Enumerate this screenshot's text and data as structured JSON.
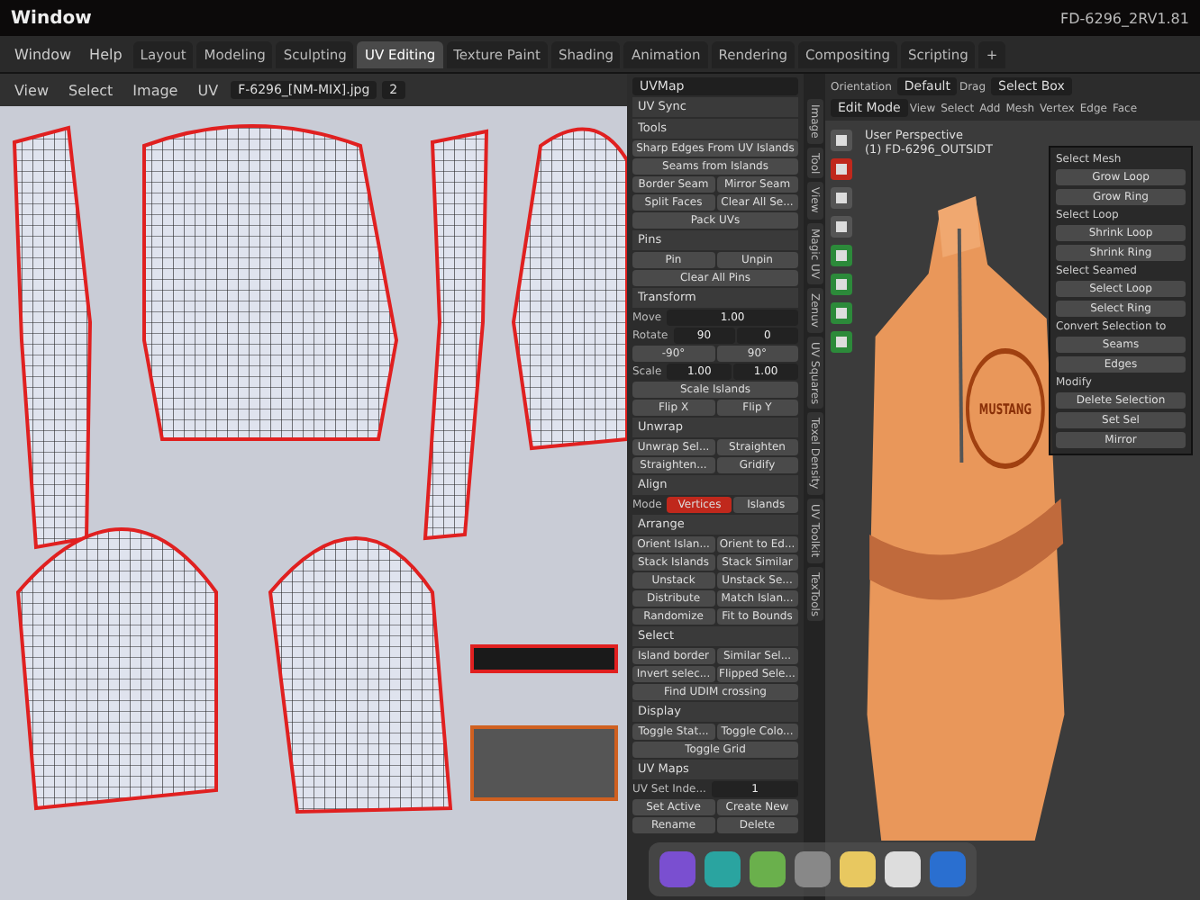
{
  "window": {
    "title": "Window",
    "file": "FD-6296_2RV1.81"
  },
  "menu": [
    "Window",
    "Help"
  ],
  "workspaces": [
    {
      "label": "Layout",
      "selected": false
    },
    {
      "label": "Modeling",
      "selected": false
    },
    {
      "label": "Sculpting",
      "selected": false
    },
    {
      "label": "UV Editing",
      "selected": true
    },
    {
      "label": "Texture Paint",
      "selected": false
    },
    {
      "label": "Shading",
      "selected": false
    },
    {
      "label": "Animation",
      "selected": false
    },
    {
      "label": "Rendering",
      "selected": false
    },
    {
      "label": "Compositing",
      "selected": false
    },
    {
      "label": "Scripting",
      "selected": false
    },
    {
      "label": "+",
      "selected": false
    }
  ],
  "uv_editor": {
    "menus": [
      "View",
      "Select",
      "Image",
      "UV"
    ],
    "image_name": "F-6296_[NM-MIX].jpg",
    "slot": "2"
  },
  "sidebar": {
    "uvmap": "UVMap",
    "sections": [
      {
        "title": "UV Sync"
      },
      {
        "title": "Tools",
        "rows": [
          {
            "kind": "buttons",
            "items": [
              "Sharp Edges From UV Islands"
            ]
          },
          {
            "kind": "buttons",
            "items": [
              "Seams from Islands"
            ]
          },
          {
            "kind": "buttons",
            "items": [
              "Border Seam",
              "Mirror Seam"
            ]
          },
          {
            "kind": "buttons",
            "items": [
              "Split Faces",
              "Clear All Se..."
            ]
          },
          {
            "kind": "buttons",
            "items": [
              "Pack UVs"
            ]
          }
        ]
      },
      {
        "title": "Pins",
        "rows": [
          {
            "kind": "buttons",
            "items": [
              "Pin",
              "Unpin"
            ]
          },
          {
            "kind": "buttons",
            "items": [
              "Clear All Pins"
            ]
          }
        ]
      },
      {
        "title": "Transform",
        "rows": [
          {
            "kind": "field",
            "label": "Move",
            "values": [
              "1.00"
            ]
          },
          {
            "kind": "field",
            "label": "Rotate",
            "values": [
              "90",
              "0"
            ]
          },
          {
            "kind": "buttons",
            "items": [
              "-90°",
              "90°"
            ]
          },
          {
            "kind": "field",
            "label": "Scale",
            "values": [
              "1.00",
              "1.00"
            ]
          },
          {
            "kind": "buttons",
            "items": [
              "Scale Islands"
            ]
          },
          {
            "kind": "buttons",
            "items": [
              "Flip X",
              "Flip Y"
            ]
          }
        ]
      },
      {
        "title": "Unwrap",
        "rows": [
          {
            "kind": "buttons",
            "items": [
              "Unwrap Sel...",
              "Straighten"
            ]
          },
          {
            "kind": "buttons",
            "items": [
              "Straighten...",
              "Gridify"
            ]
          }
        ]
      },
      {
        "title": "Align",
        "rows": [
          {
            "kind": "toggle",
            "label": "Mode",
            "options": [
              {
                "label": "Vertices",
                "selected": true
              },
              {
                "label": "Islands",
                "selected": false
              }
            ]
          }
        ]
      },
      {
        "title": "Arrange",
        "rows": [
          {
            "kind": "buttons",
            "items": [
              "Orient Islan...",
              "Orient to Ed..."
            ]
          },
          {
            "kind": "buttons",
            "items": [
              "Stack Islands",
              "Stack Similar"
            ]
          },
          {
            "kind": "buttons",
            "items": [
              "Unstack",
              "Unstack Se..."
            ]
          },
          {
            "kind": "buttons",
            "items": [
              "Distribute",
              "Match Islan..."
            ]
          },
          {
            "kind": "buttons",
            "items": [
              "Randomize",
              "Fit to Bounds"
            ]
          }
        ]
      },
      {
        "title": "Select",
        "rows": [
          {
            "kind": "buttons",
            "items": [
              "Island border",
              "Similar Sel..."
            ]
          },
          {
            "kind": "buttons",
            "items": [
              "Invert selec...",
              "Flipped Sele..."
            ]
          },
          {
            "kind": "buttons",
            "items": [
              "Find UDIM crossing"
            ]
          }
        ]
      },
      {
        "title": "Display",
        "rows": [
          {
            "kind": "buttons",
            "items": [
              "Toggle Stat...",
              "Toggle Colo..."
            ]
          },
          {
            "kind": "buttons",
            "items": [
              "Toggle Grid"
            ]
          }
        ]
      },
      {
        "title": "UV Maps",
        "rows": [
          {
            "kind": "field",
            "label": "UV Set Inde...",
            "values": [
              "1"
            ]
          },
          {
            "kind": "buttons",
            "items": [
              "Set Active",
              "Create New"
            ]
          },
          {
            "kind": "buttons",
            "items": [
              "Rename",
              "Delete"
            ]
          }
        ]
      }
    ]
  },
  "sidebar_tabs": [
    "Image",
    "Tool",
    "View",
    "Magic UV",
    "Zenuv",
    "UV Squares",
    "Texel Density",
    "UV Toolkit",
    "TexTools"
  ],
  "viewport": {
    "orientation_label": "Orientation",
    "orientation": "Default",
    "drag_label": "Drag",
    "drag": "Select Box",
    "mode": "Edit Mode",
    "menus": [
      "View",
      "Select",
      "Add",
      "Mesh",
      "Vertex",
      "Edge",
      "Face"
    ],
    "view_name": "User Perspective",
    "object": "(1) FD-6296_OUTSIDT",
    "logo": "MUSTANG"
  },
  "overlay_panel": {
    "sections": [
      {
        "title": "Select Mesh",
        "buttons": [
          "Grow Loop",
          "Grow Ring"
        ]
      },
      {
        "title": "Select Loop",
        "buttons": [
          "Shrink Loop",
          "Shrink Ring"
        ]
      },
      {
        "title": "Select Seamed",
        "buttons": [
          "Select Loop",
          "Select Ring"
        ]
      },
      {
        "title": "Convert Selection to",
        "buttons": [
          "Seams",
          "Edges"
        ]
      },
      {
        "title": "Modify",
        "buttons": [
          "Delete Selection",
          "Set Sel",
          "Mirror"
        ]
      }
    ]
  }
}
